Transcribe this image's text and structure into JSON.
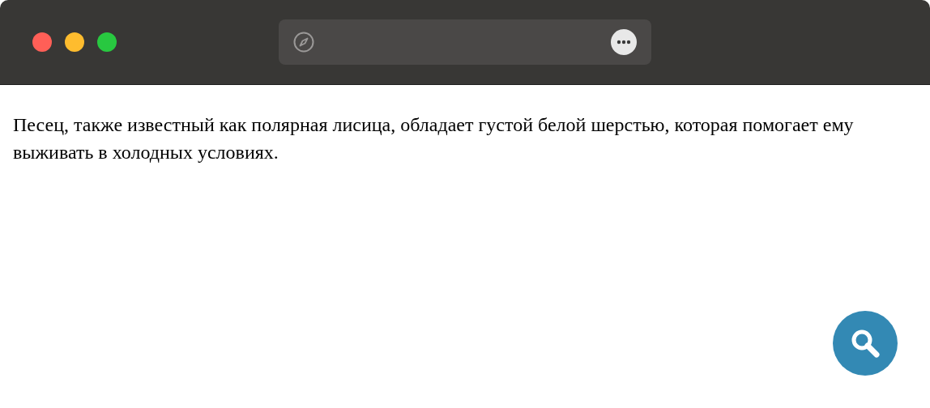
{
  "window": {
    "traffic_lights": [
      {
        "color": "#ff5f57"
      },
      {
        "color": "#febc2e"
      },
      {
        "color": "#28c840"
      }
    ]
  },
  "paragraph": "Песец, также известный как полярная лисица, обладает густой белой шерстью, которая помогает ему выживать в холодных условиях."
}
